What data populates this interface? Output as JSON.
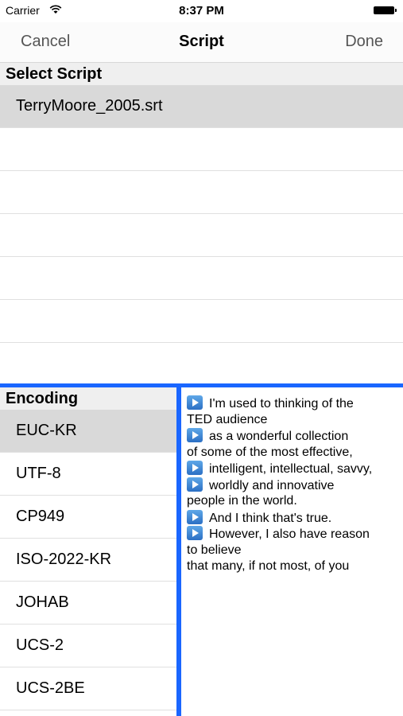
{
  "status": {
    "carrier": "Carrier",
    "time": "8:37 PM"
  },
  "nav": {
    "cancel": "Cancel",
    "title": "Script",
    "done": "Done"
  },
  "script_section": {
    "header": "Select Script",
    "items": [
      "TerryMoore_2005.srt",
      "",
      "",
      "",
      "",
      "",
      ""
    ],
    "selected_index": 0
  },
  "encoding_section": {
    "header": "Encoding",
    "items": [
      "EUC-KR",
      "UTF-8",
      "CP949",
      "ISO-2022-KR",
      "JOHAB",
      "UCS-2",
      "UCS-2BE"
    ],
    "selected_index": 0
  },
  "preview": {
    "lines": [
      {
        "play": true,
        "text": "I'm used to thinking of the"
      },
      {
        "play": false,
        "text": "TED audience"
      },
      {
        "play": true,
        "text": "as a wonderful collection"
      },
      {
        "play": false,
        "text": "of some of the most effective,"
      },
      {
        "play": true,
        "text": "intelligent, intellectual, savvy,"
      },
      {
        "play": true,
        "text": "worldly and innovative"
      },
      {
        "play": false,
        "text": "people in the world."
      },
      {
        "play": true,
        "text": "And I think that's true."
      },
      {
        "play": true,
        "text": "However, I also have reason"
      },
      {
        "play": false,
        "text": "to believe"
      },
      {
        "play": false,
        "text": "that many, if not most, of you"
      }
    ]
  },
  "colors": {
    "accent": "#1a66ff",
    "selected_row": "#d9d9d9",
    "section_header": "#efefef"
  },
  "icons": [
    "wifi-icon",
    "battery-icon",
    "play-icon"
  ]
}
